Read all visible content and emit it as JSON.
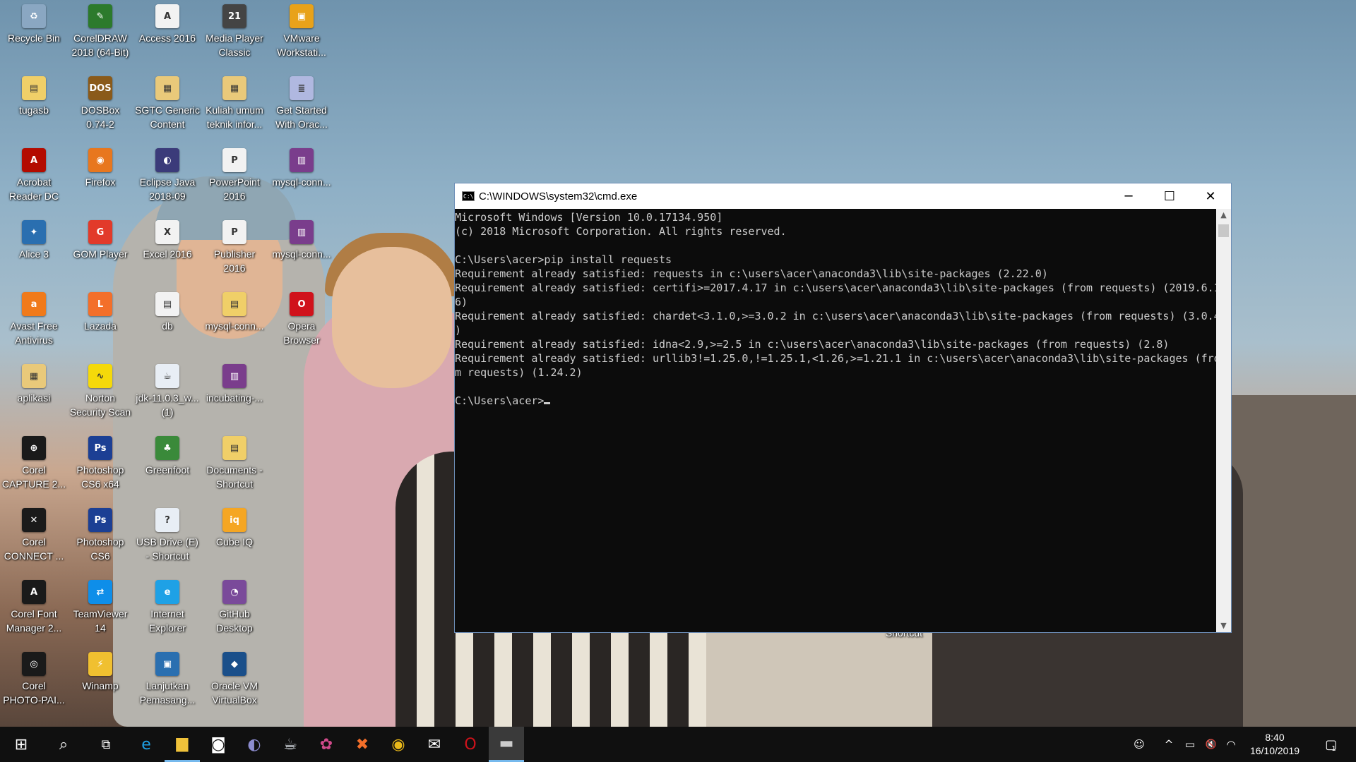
{
  "desktop": {
    "icons": [
      {
        "label": "Recycle Bin",
        "glyph": "♻",
        "color": "#8aa7c2"
      },
      {
        "label": "CorelDRAW\n2018 (64-Bit)",
        "glyph": "✎",
        "color": "#2c7a2c"
      },
      {
        "label": "Access 2016",
        "glyph": "A",
        "color": "#f2f2f2"
      },
      {
        "label": "Media Player\nClassic",
        "glyph": "21",
        "color": "#444444"
      },
      {
        "label": "VMware\nWorkstati...",
        "glyph": "▣",
        "color": "#e8a21a"
      },
      {
        "label": "tugasb",
        "glyph": "▤",
        "color": "#f0cf68"
      },
      {
        "label": "DOSBox\n0.74-2",
        "glyph": "DOS",
        "color": "#8a5a1a"
      },
      {
        "label": "SGTC Generic\nContent",
        "glyph": "▦",
        "color": "#e9c97a"
      },
      {
        "label": "Kuliah umum\nteknik infor...",
        "glyph": "▦",
        "color": "#e9c97a"
      },
      {
        "label": "Get Started\nWith Orac...",
        "glyph": "≣",
        "color": "#b0b8e0"
      },
      {
        "label": "Acrobat\nReader DC",
        "glyph": "A",
        "color": "#b30b00"
      },
      {
        "label": "Firefox",
        "glyph": "◉",
        "color": "#e8771e"
      },
      {
        "label": "Eclipse Java\n2018-09",
        "glyph": "◐",
        "color": "#3b3b7a"
      },
      {
        "label": "PowerPoint\n2016",
        "glyph": "P",
        "color": "#f2f2f2"
      },
      {
        "label": "mysql-conn...",
        "glyph": "▥",
        "color": "#7a3d8c"
      },
      {
        "label": "Alice 3",
        "glyph": "✦",
        "color": "#2a6fb0"
      },
      {
        "label": "GOM Player",
        "glyph": "G",
        "color": "#e23a2a"
      },
      {
        "label": "Excel 2016",
        "glyph": "X",
        "color": "#f2f2f2"
      },
      {
        "label": "Publisher\n2016",
        "glyph": "P",
        "color": "#f2f2f2"
      },
      {
        "label": "mysql-conn...",
        "glyph": "▥",
        "color": "#7a3d8c"
      },
      {
        "label": "Avast Free\nAntivirus",
        "glyph": "a",
        "color": "#f07a1a"
      },
      {
        "label": "Lazada",
        "glyph": "L",
        "color": "#f36f2a"
      },
      {
        "label": "db",
        "glyph": "▤",
        "color": "#f2f2f2"
      },
      {
        "label": "mysql-conn...",
        "glyph": "▤",
        "color": "#f0cf68"
      },
      {
        "label": "Opera\nBrowser",
        "glyph": "O",
        "color": "#d0121b"
      },
      {
        "label": "aplikasi",
        "glyph": "▦",
        "color": "#e9c97a"
      },
      {
        "label": "Norton\nSecurity Scan",
        "glyph": "∿",
        "color": "#f5d90a"
      },
      {
        "label": "jdk-11.0.3_w...\n(1)",
        "glyph": "☕",
        "color": "#e8eef5"
      },
      {
        "label": "incubating-...",
        "glyph": "▥",
        "color": "#7a3d8c"
      },
      {
        "label": "",
        "glyph": "",
        "color": ""
      },
      {
        "label": "Corel\nCAPTURE 2...",
        "glyph": "⊕",
        "color": "#1a1a1a"
      },
      {
        "label": "Photoshop\nCS6 x64",
        "glyph": "Ps",
        "color": "#1c3f94"
      },
      {
        "label": "Greenfoot",
        "glyph": "♣",
        "color": "#3a8a3a"
      },
      {
        "label": "Documents -\nShortcut",
        "glyph": "▤",
        "color": "#f0cf68"
      },
      {
        "label": "",
        "glyph": "",
        "color": ""
      },
      {
        "label": "Corel\nCONNECT ...",
        "glyph": "✕",
        "color": "#1a1a1a"
      },
      {
        "label": "Photoshop\nCS6",
        "glyph": "Ps",
        "color": "#1c3f94"
      },
      {
        "label": "USB Drive (E)\n- Shortcut",
        "glyph": "?",
        "color": "#e8eef5"
      },
      {
        "label": "Cube IQ",
        "glyph": "iq",
        "color": "#f5a623"
      },
      {
        "label": "",
        "glyph": "",
        "color": ""
      },
      {
        "label": "Corel Font\nManager 2...",
        "glyph": "A",
        "color": "#1a1a1a"
      },
      {
        "label": "TeamViewer\n14",
        "glyph": "⇄",
        "color": "#0e8ee9"
      },
      {
        "label": "Internet\nExplorer",
        "glyph": "e",
        "color": "#1ea1e6"
      },
      {
        "label": "GitHub\nDesktop",
        "glyph": "◔",
        "color": "#7a4a9a"
      },
      {
        "label": "",
        "glyph": "",
        "color": ""
      },
      {
        "label": "Corel\nPHOTO-PAI...",
        "glyph": "◎",
        "color": "#1a1a1a"
      },
      {
        "label": "Winamp",
        "glyph": "⚡",
        "color": "#f0c030"
      },
      {
        "label": "Lanjutkan\nPemasang...",
        "glyph": "▣",
        "color": "#2a6fb0"
      },
      {
        "label": "Oracle VM\nVirtualBox",
        "glyph": "◆",
        "color": "#1a4f8a"
      },
      {
        "label": "",
        "glyph": "",
        "color": ""
      }
    ],
    "hidden_shortcut_label": "Shortcut"
  },
  "cmd": {
    "title": "C:\\WINDOWS\\system32\\cmd.exe",
    "icon_text": "C:\\",
    "minimize": "─",
    "maximize": "☐",
    "close": "✕",
    "lines": [
      "Microsoft Windows [Version 10.0.17134.950]",
      "(c) 2018 Microsoft Corporation. All rights reserved.",
      "",
      "C:\\Users\\acer>pip install requests",
      "Requirement already satisfied: requests in c:\\users\\acer\\anaconda3\\lib\\site-packages (2.22.0)",
      "Requirement already satisfied: certifi>=2017.4.17 in c:\\users\\acer\\anaconda3\\lib\\site-packages (from requests) (2019.6.1",
      "6)",
      "Requirement already satisfied: chardet<3.1.0,>=3.0.2 in c:\\users\\acer\\anaconda3\\lib\\site-packages (from requests) (3.0.4",
      ")",
      "Requirement already satisfied: idna<2.9,>=2.5 in c:\\users\\acer\\anaconda3\\lib\\site-packages (from requests) (2.8)",
      "Requirement already satisfied: urllib3!=1.25.0,!=1.25.1,<1.26,>=1.21.1 in c:\\users\\acer\\anaconda3\\lib\\site-packages (fro",
      "m requests) (1.24.2)",
      ""
    ],
    "prompt": "C:\\Users\\acer>",
    "scroll_up": "▲",
    "scroll_down": "▼"
  },
  "taskbar": {
    "start_icon": "⊞",
    "search_icon": "⌕",
    "taskview_icon": "⧉",
    "apps": [
      {
        "name": "internet-explorer",
        "glyph": "e",
        "color": "#1ea1e6",
        "running": false
      },
      {
        "name": "file-explorer",
        "glyph": "▆",
        "color": "#f0c23a",
        "running": true
      },
      {
        "name": "camera",
        "glyph": "◙",
        "color": "#ffffff",
        "running": false
      },
      {
        "name": "eclipse",
        "glyph": "◐",
        "color": "#8c8cd0",
        "running": false
      },
      {
        "name": "java-installer",
        "glyph": "☕",
        "color": "#e8eef5",
        "running": false
      },
      {
        "name": "paint",
        "glyph": "✿",
        "color": "#d04a8a",
        "running": false
      },
      {
        "name": "xampp",
        "glyph": "✖",
        "color": "#f36f2a",
        "running": false
      },
      {
        "name": "chrome",
        "glyph": "◉",
        "color": "#e9b81a",
        "running": false
      },
      {
        "name": "mail",
        "glyph": "✉",
        "color": "#ffffff",
        "running": false
      },
      {
        "name": "opera",
        "glyph": "O",
        "color": "#d0121b",
        "running": false
      },
      {
        "name": "command-prompt",
        "glyph": "▬",
        "color": "#cccccc",
        "running": true
      }
    ],
    "tray": {
      "people_icon": "☺",
      "chevron_icon": "^",
      "battery_icon": "▭",
      "volume_icon": "🔇",
      "wifi_icon": "◠",
      "time": "8:40",
      "date": "16/10/2019",
      "notification_icon": "▢",
      "notification_count": "1"
    }
  }
}
